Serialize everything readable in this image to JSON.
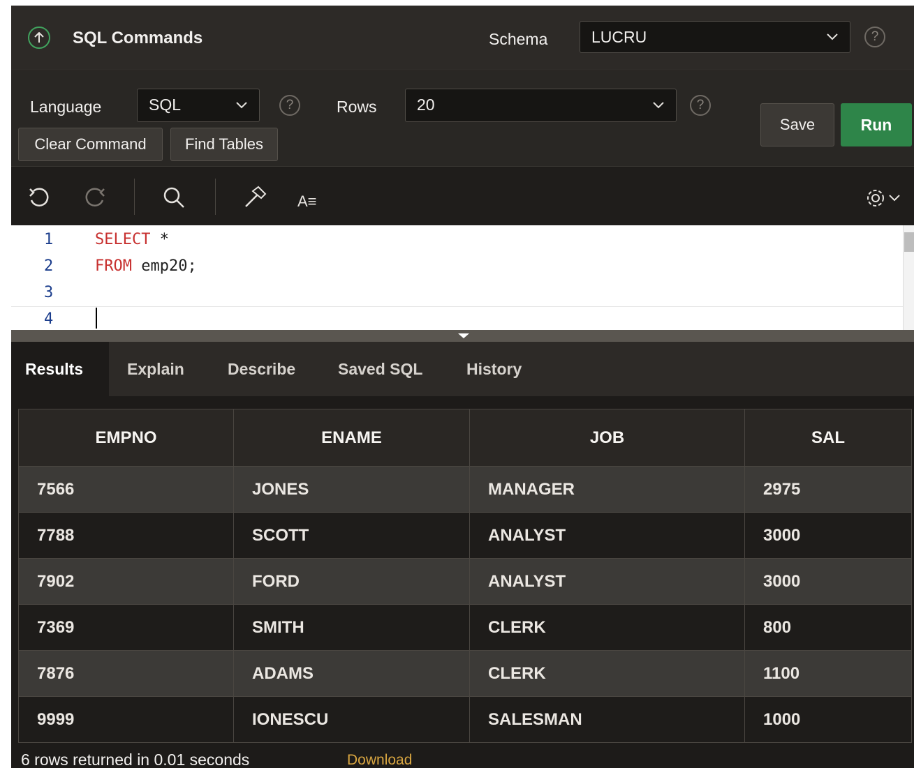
{
  "header": {
    "title": "SQL Commands",
    "schema_label": "Schema",
    "schema_value": "LUCRU",
    "help": "?"
  },
  "toolbar": {
    "language_label": "Language",
    "language_value": "SQL",
    "rows_label": "Rows",
    "rows_value": "20",
    "help": "?",
    "clear_command": "Clear Command",
    "find_tables": "Find Tables",
    "save": "Save",
    "run": "Run"
  },
  "editor_toolbar": {
    "format_label": "A≡"
  },
  "editor": {
    "line_numbers": [
      "1",
      "2",
      "3",
      "4"
    ],
    "line1_keyword": "SELECT",
    "line1_rest": " *",
    "line2_keyword": "FROM",
    "line2_rest": " emp20;"
  },
  "tabs": [
    "Results",
    "Explain",
    "Describe",
    "Saved SQL",
    "History"
  ],
  "results": {
    "columns": [
      "EMPNO",
      "ENAME",
      "JOB",
      "SAL"
    ],
    "rows": [
      [
        "7566",
        "JONES",
        "MANAGER",
        "2975"
      ],
      [
        "7788",
        "SCOTT",
        "ANALYST",
        "3000"
      ],
      [
        "7902",
        "FORD",
        "ANALYST",
        "3000"
      ],
      [
        "7369",
        "SMITH",
        "CLERK",
        "800"
      ],
      [
        "7876",
        "ADAMS",
        "CLERK",
        "1100"
      ],
      [
        "9999",
        "IONESCU",
        "SALESMAN",
        "1000"
      ]
    ],
    "status": "6 rows returned in 0.01 seconds",
    "download": "Download"
  },
  "colors": {
    "accent_green": "#2e8549",
    "download_link": "#d9a641",
    "keyword": "#c7302f"
  }
}
